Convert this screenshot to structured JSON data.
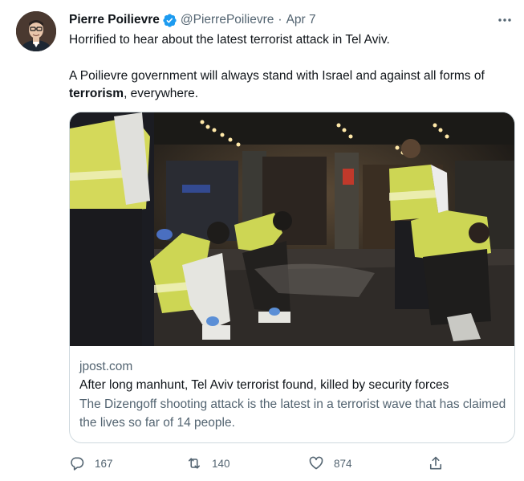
{
  "author": {
    "name": "Pierre Poilievre",
    "handle": "@PierrePoilievre",
    "separator": "·",
    "date": "Apr 7",
    "avatar_icon": "user-avatar",
    "verified_icon": "verified-badge-icon"
  },
  "tweet": {
    "line1": "Horrified to hear about the latest terrorist attack in Tel Aviv.",
    "line2": "A Poilievre government will always stand with Israel and against all forms of",
    "line3_bold": "terrorism",
    "line3_rest": ", everywhere."
  },
  "card": {
    "domain": "jpost.com",
    "title": "After long manhunt, Tel Aviv terrorist found, killed by security forces",
    "description": "The Dizengoff shooting attack is the latest in a terrorist wave that has claimed the lives so far of 14 people."
  },
  "actions": {
    "replies": "167",
    "retweets": "140",
    "likes": "874"
  },
  "colors": {
    "text": "#0f1419",
    "secondary": "#536471",
    "verified": "#1d9bf0",
    "border": "#cfd9de"
  }
}
